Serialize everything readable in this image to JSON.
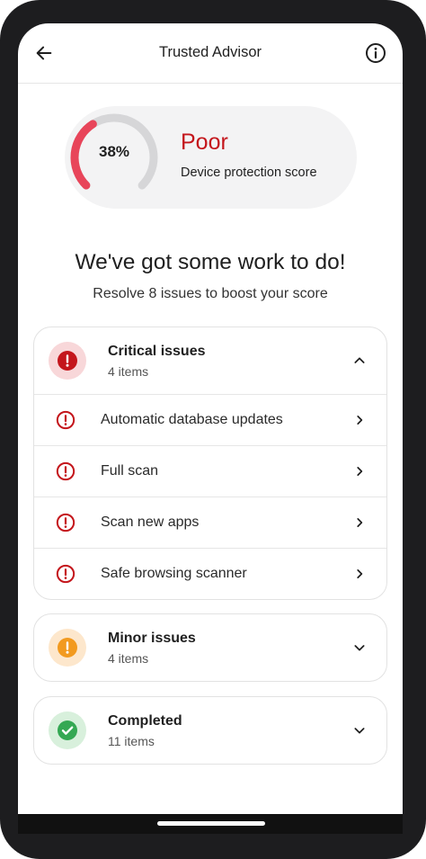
{
  "header": {
    "title": "Trusted Advisor"
  },
  "score": {
    "percent_text": "38%",
    "percent_value": 38,
    "rating": "Poor",
    "description": "Device protection score",
    "rating_color": "#c4161c"
  },
  "summary": {
    "headline": "We've got some work to do!",
    "subtext": "Resolve 8 issues to boost your score"
  },
  "critical": {
    "title": "Critical issues",
    "count": "4 items",
    "color": "#c4161c",
    "expanded": true,
    "items": [
      {
        "label": "Automatic database updates"
      },
      {
        "label": "Full scan"
      },
      {
        "label": "Scan new apps"
      },
      {
        "label": "Safe browsing scanner"
      }
    ]
  },
  "minor": {
    "title": "Minor issues",
    "count": "4 items",
    "color": "#f29a1f",
    "expanded": false
  },
  "completed": {
    "title": "Completed",
    "count": "11 items",
    "color": "#34a853",
    "expanded": false
  }
}
